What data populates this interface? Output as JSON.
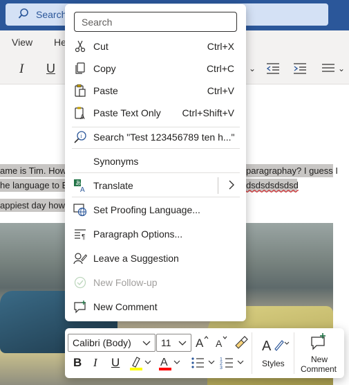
{
  "titlebar": {
    "search_label": "Search"
  },
  "menubar": {
    "items": [
      "View",
      "He"
    ]
  },
  "ribbon": {
    "italic": "I",
    "underline": "U"
  },
  "document": {
    "line1_left": "ame is Tim. How",
    "line1_right": "paragraphay? I guess I",
    "line2_left": "he language to E",
    "line2_right": "dsdsdsdsdsd",
    "line3_left": "appiest day how"
  },
  "context_menu": {
    "search_placeholder": "Search",
    "items": [
      {
        "label": "Cut",
        "shortcut": "Ctrl+X",
        "icon": "scissors-icon"
      },
      {
        "label": "Copy",
        "shortcut": "Ctrl+C",
        "icon": "copy-icon"
      },
      {
        "label": "Paste",
        "shortcut": "Ctrl+V",
        "icon": "paste-icon"
      },
      {
        "label": "Paste Text Only",
        "shortcut": "Ctrl+Shift+V",
        "icon": "paste-text-icon"
      },
      {
        "label": "Search \"Test 123456789 ten h...\"",
        "icon": "smart-lookup-icon"
      },
      {
        "label": "Synonyms"
      },
      {
        "label": "Translate",
        "icon": "translate-icon"
      },
      {
        "label": "Set Proofing Language...",
        "icon": "language-globe-icon"
      },
      {
        "label": "Paragraph Options...",
        "icon": "paragraph-icon"
      },
      {
        "label": "Leave a Suggestion",
        "icon": "suggestion-icon"
      },
      {
        "label": "New Follow-up",
        "icon": "follow-up-icon",
        "disabled": true
      },
      {
        "label": "New Comment",
        "icon": "comment-icon"
      }
    ]
  },
  "mini_toolbar": {
    "font_name": "Calibri (Body)",
    "font_size": "11",
    "bold": "B",
    "italic": "I",
    "underline": "U",
    "styles_label": "Styles",
    "new_comment_line1": "New",
    "new_comment_line2": "Comment",
    "highlight_color": "#ffff00",
    "font_color": "#ff0000"
  }
}
